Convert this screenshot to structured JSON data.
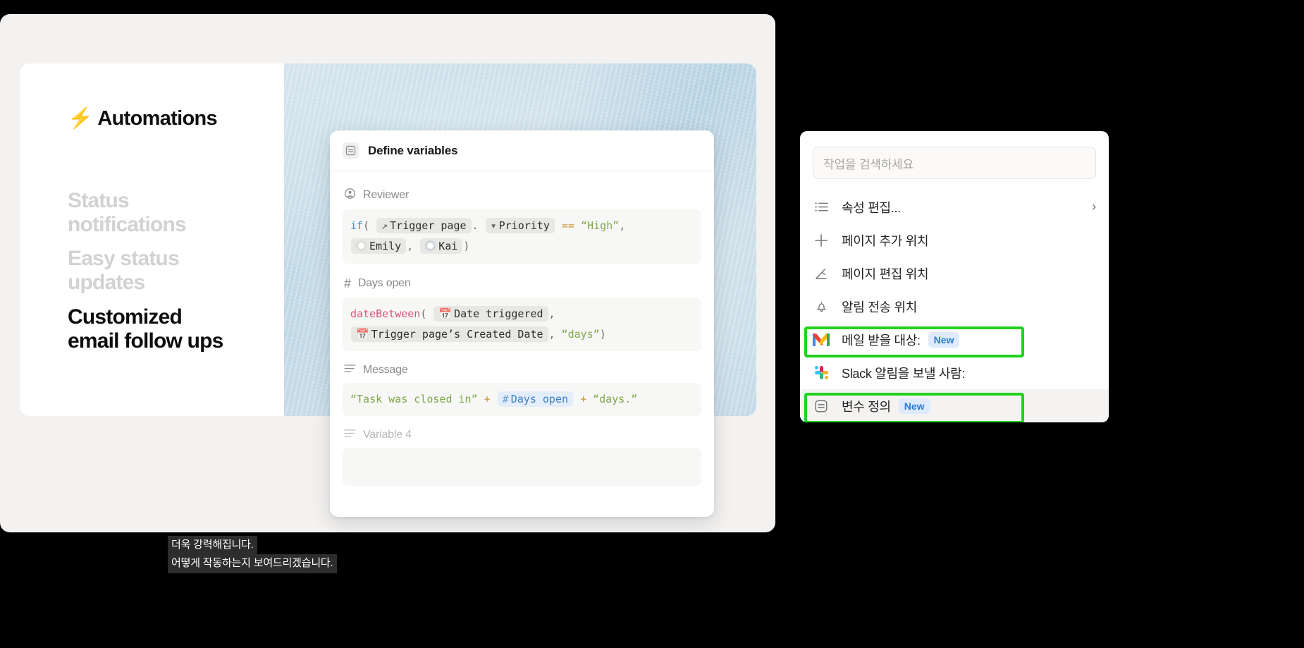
{
  "promo": {
    "brand_icon": "bolt-icon",
    "brand": "Automations",
    "line1": "Status\nnotifications",
    "line2": "Easy status\nupdates",
    "line3": "Customized\nemail follow ups"
  },
  "define_card": {
    "header_icon": "variable-definition-icon",
    "title": "Define variables",
    "variables": [
      {
        "icon": "person-icon",
        "label": "Reviewer",
        "code_line1": {
          "fn": "if",
          "open": "(",
          "chip1_icon": "arrow-up-right-icon",
          "chip1": "Trigger page",
          "dot": ".",
          "chip2_icon": "select-circle-icon",
          "chip2": "Priority",
          "op": "==",
          "str": "“High”",
          "comma": ","
        },
        "code_line2": {
          "chip1_icon": "avatar-emily",
          "chip1": "Emily",
          "comma": ",",
          "chip2_icon": "avatar-kai",
          "chip2": "Kai",
          "close": ")"
        }
      },
      {
        "icon": "number-hash-icon",
        "label": "Days open",
        "code_line1": {
          "fn": "dateBetween",
          "open": "(",
          "chip1_icon": "calendar-icon",
          "chip1": "Date triggered",
          "comma": ","
        },
        "code_line2": {
          "chip1_icon": "calendar-icon",
          "chip1": "Trigger page’s Created Date",
          "comma": ",",
          "str": "“days”",
          "close": ")"
        }
      },
      {
        "icon": "text-lines-icon",
        "label": "Message",
        "code_line1": {
          "str1": "“Task was closed in”",
          "plus1": "+",
          "chip_icon": "number-hash-icon",
          "chip": "Days open",
          "plus2": "+",
          "str2": "“days.”"
        }
      },
      {
        "icon": "text-lines-icon",
        "label": "Variable 4",
        "empty": true
      }
    ]
  },
  "subtitle": {
    "line1": "더욱 강력해집니다.",
    "line2": "어떻게 작동하는지 보여드리겠습니다."
  },
  "menu": {
    "search_placeholder": "작업을 검색하세요",
    "items": [
      {
        "icon": "list-icon",
        "label": "속성 편집...",
        "chevron": "›",
        "badge": "",
        "highlighted": false,
        "selected": false
      },
      {
        "icon": "plus-icon",
        "label": "페이지 추가 위치",
        "chevron": "",
        "badge": "",
        "highlighted": false,
        "selected": false
      },
      {
        "icon": "pencil-icon",
        "label": "페이지 편집 위치",
        "chevron": "",
        "badge": "",
        "highlighted": false,
        "selected": false
      },
      {
        "icon": "bell-icon",
        "label": "알림 전송 위치",
        "chevron": "",
        "badge": "",
        "highlighted": false,
        "selected": false
      },
      {
        "icon": "gmail-icon",
        "label": "메일 받을 대상:",
        "chevron": "",
        "badge": "New",
        "highlighted": true,
        "selected": false
      },
      {
        "icon": "slack-icon",
        "label": "Slack 알림을 보낼 사람:",
        "chevron": "",
        "badge": "",
        "highlighted": false,
        "selected": false
      },
      {
        "icon": "variable-definition-icon",
        "label": "변수 정의",
        "chevron": "",
        "badge": "New",
        "highlighted": true,
        "selected": true
      }
    ]
  },
  "colors": {
    "highlight_green": "#1fd21f",
    "badge_blue": "#2b7bd6",
    "accent_blue": "#3a8ec4",
    "string_green": "#7fa84a"
  }
}
